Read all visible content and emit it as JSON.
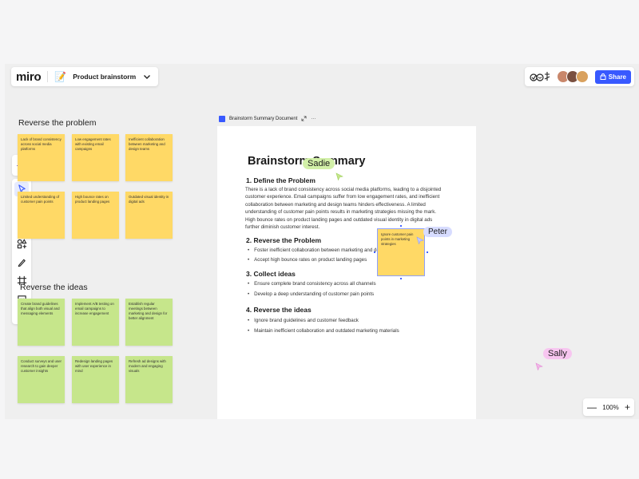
{
  "app": {
    "logo": "miro",
    "board_emoji": "📝",
    "board_name": "Product brainstorm",
    "share_label": "Share",
    "zoom_level": "100%",
    "zoom_out": "—",
    "zoom_in": "+"
  },
  "sections": {
    "reverse_problem": "Reverse the problem",
    "reverse_ideas": "Reverse the ideas"
  },
  "notes_problem": [
    "Lack of brand consistency across social media platforms",
    "Low engagement rates with existing email campaigns",
    "Inefficient collaboration between marketing and design teams",
    "Limited understanding of customer pain points",
    "High bounce rates on product landing pages",
    "Outdated visual identity in digital ads"
  ],
  "notes_ideas": [
    "Create brand guidelines that align both visual and messaging elements",
    "Implement A/B testing on email campaigns to increase engagement",
    "Establish regular meetings between marketing and design for better alignment",
    "Conduct surveys and user research to gain deeper customer insights",
    "Redesign landing pages with user experience in mind",
    "Refresh ad designs with modern and engaging visuals"
  ],
  "doc": {
    "header_title": "Brainstorm Summary Document",
    "more": "···",
    "title": "Brainstorm Summary",
    "s1_title": "1. Define the Problem",
    "s1_body": "There is a lack of brand consistency across social media platforms, leading to a disjointed customer experience. Email campaigns suffer from low engagement rates, and inefficient collaboration between marketing and design teams hinders effectiveness. A limited understanding of customer pain points results in marketing strategies missing the mark. High bounce rates on product landing pages and outdated visual identity in digital ads further diminish customer interest.",
    "s2_title": "2. Reverse the Problem",
    "s2_items": [
      "Foster inefficient collaboration between marketing and design",
      "Accept high bounce rates on product landing pages"
    ],
    "s3_title": "3. Collect ideas",
    "s3_items": [
      "Ensure complete brand consistency across all channels",
      "Develop a deep understanding of customer pain points"
    ],
    "s4_title": "4. Reverse the ideas",
    "s4_items": [
      "Ignore brand guidelines and customer feedback",
      "Maintain inefficient collaboration and outdated marketing materials"
    ],
    "note_text": "Ignore customer pain points in marketing strategies"
  },
  "cursors": {
    "sadie": "Sadie",
    "peter": "Peter",
    "sally": "Sally"
  },
  "colors": {
    "accent": "#3859ff",
    "sticky_yellow": "#ffd966",
    "sticky_green": "#c6e68b",
    "sadie": "#d2f0a8",
    "peter": "#d7dcff",
    "sally": "#f7c6f0"
  },
  "icons": [
    "chevron-down-icon",
    "reactions-icon",
    "share-lock-icon",
    "sparkle-icon",
    "select-icon",
    "sticky-note-icon",
    "text-icon",
    "shapes-icon",
    "pen-icon",
    "frame-icon",
    "comment-icon",
    "plus-icon",
    "doc-icon",
    "expand-icon"
  ]
}
